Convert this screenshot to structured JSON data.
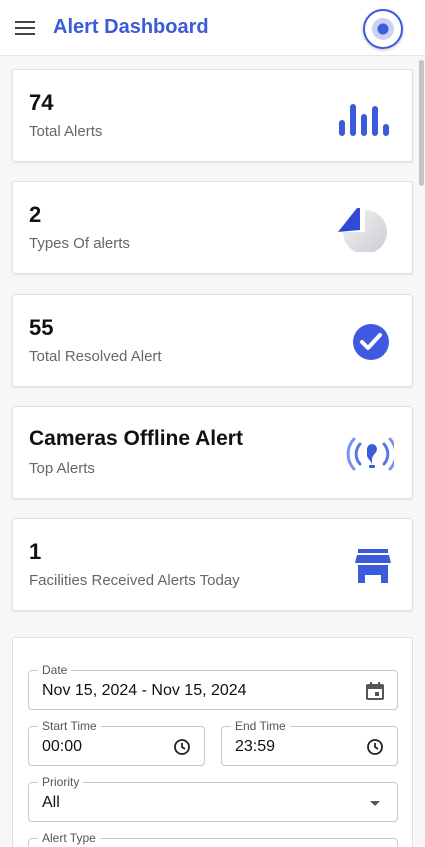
{
  "app": {
    "title": "Alert Dashboard"
  },
  "cards": [
    {
      "value": "74",
      "label": "Total Alerts",
      "icon": "bar-chart-icon"
    },
    {
      "value": "2",
      "label": "Types Of alerts",
      "icon": "pie-chart-icon"
    },
    {
      "value": "55",
      "label": "Total Resolved Alert",
      "icon": "check-circle-icon"
    },
    {
      "value": "Cameras Offline Alert",
      "label": "Top Alerts",
      "icon": "broadcast-icon"
    },
    {
      "value": "1",
      "label": "Facilities Received Alerts Today",
      "icon": "store-icon"
    }
  ],
  "filters": {
    "date": {
      "label": "Date",
      "value": "Nov 15, 2024 - Nov 15, 2024",
      "icon": "calendar-icon"
    },
    "start_time": {
      "label": "Start Time",
      "value": "00:00",
      "icon": "clock-icon"
    },
    "end_time": {
      "label": "End Time",
      "value": "23:59",
      "icon": "clock-icon"
    },
    "priority": {
      "label": "Priority",
      "value": "All",
      "icon": "dropdown-arrow-icon"
    },
    "alert_type": {
      "label": "Alert Type"
    }
  },
  "colors": {
    "accent": "#3b5bdb",
    "check": "#3f5ae0"
  }
}
